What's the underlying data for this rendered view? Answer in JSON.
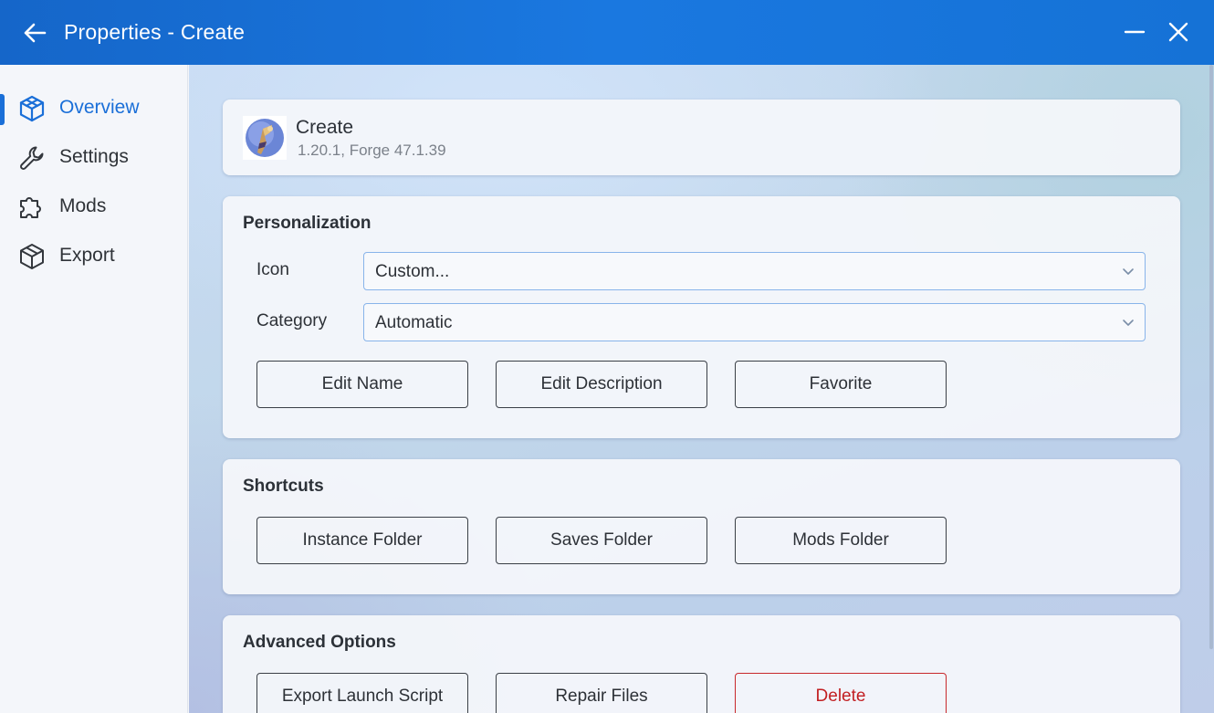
{
  "window": {
    "title": "Properties - Create"
  },
  "sidebar": {
    "items": [
      {
        "label": "Overview",
        "icon": "cube-outline-icon",
        "active": true
      },
      {
        "label": "Settings",
        "icon": "wrench-icon",
        "active": false
      },
      {
        "label": "Mods",
        "icon": "puzzle-icon",
        "active": false
      },
      {
        "label": "Export",
        "icon": "package-icon",
        "active": false
      }
    ]
  },
  "instance": {
    "name": "Create",
    "version": "1.20.1, Forge 47.1.39",
    "icon": "create-mod-logo"
  },
  "personalization": {
    "title": "Personalization",
    "icon_label": "Icon",
    "icon_value": "Custom...",
    "category_label": "Category",
    "category_value": "Automatic",
    "buttons": {
      "edit_name": "Edit Name",
      "edit_description": "Edit Description",
      "favorite": "Favorite"
    }
  },
  "shortcuts": {
    "title": "Shortcuts",
    "buttons": {
      "instance_folder": "Instance Folder",
      "saves_folder": "Saves Folder",
      "mods_folder": "Mods Folder"
    }
  },
  "advanced": {
    "title": "Advanced Options",
    "buttons": {
      "export_launch_script": "Export Launch Script",
      "repair_files": "Repair Files",
      "delete": "Delete"
    }
  },
  "colors": {
    "accent": "#1a6fd8",
    "titlebar": "#1572d6",
    "danger": "#c21f22"
  }
}
